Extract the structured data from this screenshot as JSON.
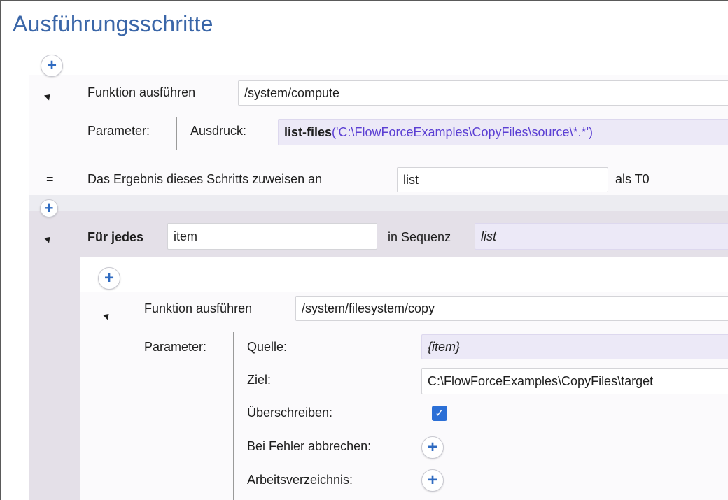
{
  "title": "Ausführungsschritte",
  "step1": {
    "label": "Funktion ausführen",
    "function_path": "/system/compute",
    "params_label": "Parameter:",
    "expr_label": "Ausdruck:",
    "expr_fn": "list-files",
    "expr_args": "('C:\\FlowForceExamples\\CopyFiles\\source\\*.*')",
    "assign_symbol": "=",
    "assign_label": "Das Ergebnis dieses Schritts zuweisen an",
    "assign_value": "list",
    "assign_as": "als T0"
  },
  "foreach": {
    "label": "Für jedes",
    "item_value": "item",
    "in_seq_label": "in Sequenz",
    "seq_value": "list"
  },
  "step2": {
    "label": "Funktion ausführen",
    "function_path": "/system/filesystem/copy",
    "params_label": "Parameter:",
    "source_label": "Quelle:",
    "source_value": "{item}",
    "target_label": "Ziel:",
    "target_value": "C:\\FlowForceExamples\\CopyFiles\\target",
    "overwrite_label": "Überschreiben:",
    "overwrite_checked": true,
    "abort_label": "Bei Fehler abbrechen:",
    "workdir_label": "Arbeitsverzeichnis:"
  },
  "icons": {
    "add": "plus-circle-icon",
    "collapse": "triangle-collapse-icon",
    "check": "checkmark-icon"
  },
  "colors": {
    "title": "#3a66a8",
    "accent": "#2f6bc1",
    "expression": "#5b3fd3",
    "checkbox": "#2b6fd6"
  }
}
